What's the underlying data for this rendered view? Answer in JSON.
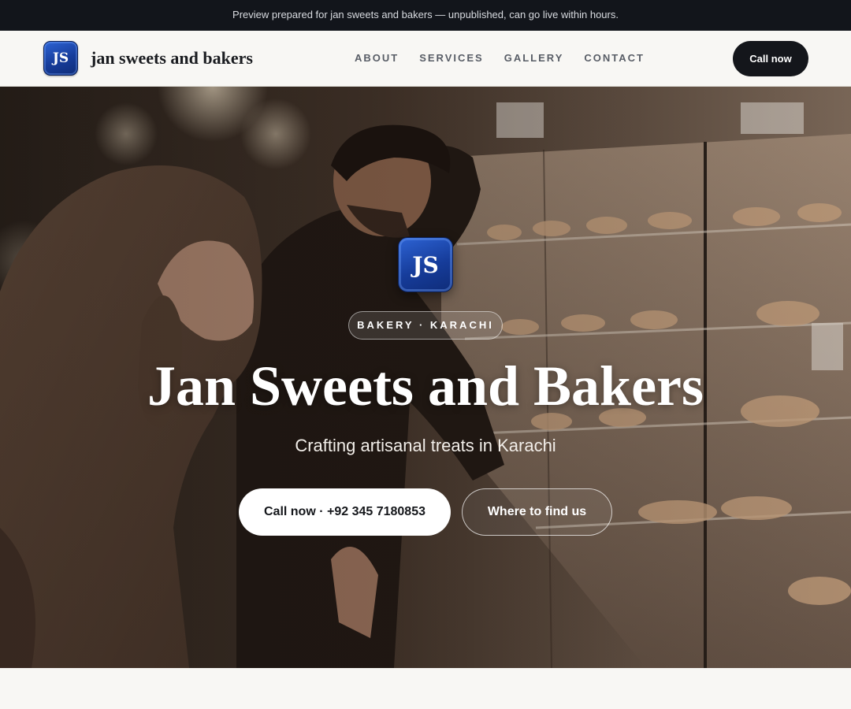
{
  "preview_bar": {
    "text": "Preview prepared for jan sweets and bakers — unpublished, can go live within hours."
  },
  "header": {
    "logo_initials": "JS",
    "brand_name": "jan sweets and bakers",
    "nav": [
      "ABOUT",
      "SERVICES",
      "GALLERY",
      "CONTACT"
    ],
    "cta_label": "Call now"
  },
  "hero": {
    "logo_initials": "JS",
    "tag": "BAKERY · KARACHI",
    "title": "Jan Sweets and Bakers",
    "subtitle": "Crafting artisanal treats in Karachi",
    "primary_button": "Call now · +92 345 7180853",
    "secondary_button": "Where to find us",
    "photo_icon": "bakery-photo"
  },
  "colors": {
    "accent_blue": "#1c4bb8",
    "dark": "#14161b",
    "background": "#f8f7f4"
  }
}
